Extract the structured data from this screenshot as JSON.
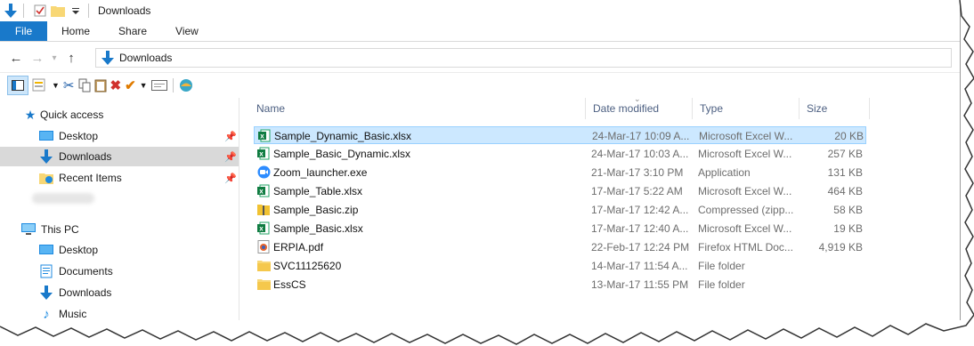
{
  "window": {
    "title": "Downloads"
  },
  "ribbon": {
    "tabs": [
      "File",
      "Home",
      "Share",
      "View"
    ]
  },
  "address": {
    "path": "Downloads"
  },
  "navigation": {
    "quick_access": "Quick access",
    "quick_items": [
      {
        "label": "Desktop",
        "icon": "desktop-icon",
        "pinned": true
      },
      {
        "label": "Downloads",
        "icon": "download-arrow-icon",
        "pinned": true,
        "selected": true
      },
      {
        "label": "Recent Items",
        "icon": "recent-items-icon",
        "pinned": true
      }
    ],
    "this_pc": "This PC",
    "pc_items": [
      {
        "label": "Desktop",
        "icon": "desktop-icon"
      },
      {
        "label": "Documents",
        "icon": "documents-icon"
      },
      {
        "label": "Downloads",
        "icon": "download-arrow-icon"
      },
      {
        "label": "Music",
        "icon": "music-icon"
      }
    ]
  },
  "columns": {
    "name": "Name",
    "date": "Date modified",
    "type": "Type",
    "size": "Size"
  },
  "files": [
    {
      "name": "Sample_Dynamic_Basic.xlsx",
      "date": "24-Mar-17 10:09 A...",
      "type": "Microsoft Excel W...",
      "size": "20 KB",
      "icon": "excel-icon",
      "selected": true
    },
    {
      "name": "Sample_Basic_Dynamic.xlsx",
      "date": "24-Mar-17 10:03 A...",
      "type": "Microsoft Excel W...",
      "size": "257 KB",
      "icon": "excel-icon"
    },
    {
      "name": "Zoom_launcher.exe",
      "date": "21-Mar-17 3:10 PM",
      "type": "Application",
      "size": "131 KB",
      "icon": "zoom-icon"
    },
    {
      "name": "Sample_Table.xlsx",
      "date": "17-Mar-17 5:22 AM",
      "type": "Microsoft Excel W...",
      "size": "464 KB",
      "icon": "excel-icon"
    },
    {
      "name": "Sample_Basic.zip",
      "date": "17-Mar-17 12:42 A...",
      "type": "Compressed (zipp...",
      "size": "58 KB",
      "icon": "zip-icon"
    },
    {
      "name": "Sample_Basic.xlsx",
      "date": "17-Mar-17 12:40 A...",
      "type": "Microsoft Excel W...",
      "size": "19 KB",
      "icon": "excel-icon"
    },
    {
      "name": "ERPIA.pdf",
      "date": "22-Feb-17 12:24 PM",
      "type": "Firefox HTML Doc...",
      "size": "4,919 KB",
      "icon": "pdf-icon"
    },
    {
      "name": "SVC11125620",
      "date": "14-Mar-17 11:54 A...",
      "type": "File folder",
      "size": "",
      "icon": "folder-icon"
    },
    {
      "name": "EssCS",
      "date": "13-Mar-17 11:55 PM",
      "type": "File folder",
      "size": "",
      "icon": "folder-icon"
    }
  ],
  "colors": {
    "accent": "#1979ca",
    "selection": "#cce8ff",
    "selection_border": "#99d1ff",
    "nav_selected": "#d9d9d9",
    "header_text": "#4d6082"
  }
}
